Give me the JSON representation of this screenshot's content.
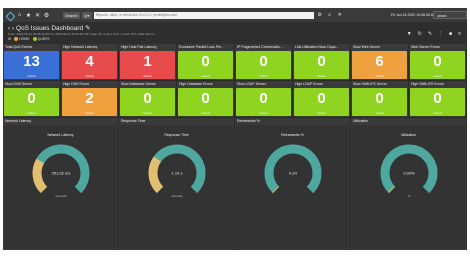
{
  "topnav": {
    "icons": [
      "menu-icon",
      "home-icon",
      "star-icon",
      "tools-icon",
      "settings-icon"
    ],
    "search_scope": "Search",
    "search_placeholder": "Reports, sites, or items like 10.0.0.1, jsmith@ex.com",
    "clock": "Fri Jun 24 2022 10:46:30 AM",
    "user": "ADMIN DASHBOARD"
  },
  "header": {
    "title": "QoS Issues Dashboard",
    "subtitle": "From: 2022-06-24 09:46:30 AM  To: 2022-06-24 10:46:30 AM  |  Step: 60  |  Last 1 hour  |  Local: NTC Data Source",
    "crumbs": [
      "HOME",
      "QUERY"
    ],
    "actions": [
      "filter-icon",
      "refresh-icon",
      "edit-icon",
      "more-icon",
      "fullscreen-icon"
    ]
  },
  "colors": {
    "blue": "#3a6fd8",
    "red": "#e84b4b",
    "green": "#8fd421",
    "orange": "#f0a03c"
  },
  "count_label": "Count",
  "tiles": [
    {
      "label": "Total QoS Events",
      "value": "13",
      "color": "blue"
    },
    {
      "label": "High Network Latency",
      "value": "4",
      "color": "red"
    },
    {
      "label": "High Host Pair Latency",
      "value": "1",
      "color": "red"
    },
    {
      "label": "Excessive Packet Loss Per ...",
      "value": "0",
      "color": "green"
    },
    {
      "label": "IP Fragmented Conversatio...",
      "value": "0",
      "color": "green"
    },
    {
      "label": "Link Utilization Near Capa...",
      "value": "0",
      "color": "green"
    },
    {
      "label": "Slow Web Server",
      "value": "6",
      "color": "orange"
    },
    {
      "label": "Web Server Errors",
      "value": "0",
      "color": "green"
    },
    {
      "label": "Slow DNS Server",
      "value": "0",
      "color": "green"
    },
    {
      "label": "High DNS Errors",
      "value": "2",
      "color": "orange"
    },
    {
      "label": "Slow Database Server",
      "value": "0",
      "color": "green"
    },
    {
      "label": "High Database Errors",
      "value": "0",
      "color": "green"
    },
    {
      "label": "Slow LDAP Server",
      "value": "0",
      "color": "green"
    },
    {
      "label": "High LDAP Errors",
      "value": "0",
      "color": "green"
    },
    {
      "label": "Slow SMB-IFS Server",
      "value": "0",
      "color": "green"
    },
    {
      "label": "High SMB-IFS Errors",
      "value": "0",
      "color": "green"
    }
  ],
  "gauges": [
    {
      "panel": "Network Latency",
      "title": "Network Latency",
      "value": "251.02 ms",
      "unit": "seconds",
      "fraction": 0.28
    },
    {
      "panel": "Response Time",
      "title": "Response Time",
      "value": "1.14 s",
      "unit": "seconds",
      "fraction": 0.3
    },
    {
      "panel": "Retransmits %",
      "title": "Retransmits %",
      "value": "0.24",
      "unit": "",
      "fraction": 0.01
    },
    {
      "panel": "Utilization",
      "title": "Utilization",
      "value": "0.09%",
      "unit": "%",
      "fraction": 0.01
    }
  ],
  "gauge_colors": {
    "filled": "#e0c070",
    "rest": "#4fa8a0"
  }
}
